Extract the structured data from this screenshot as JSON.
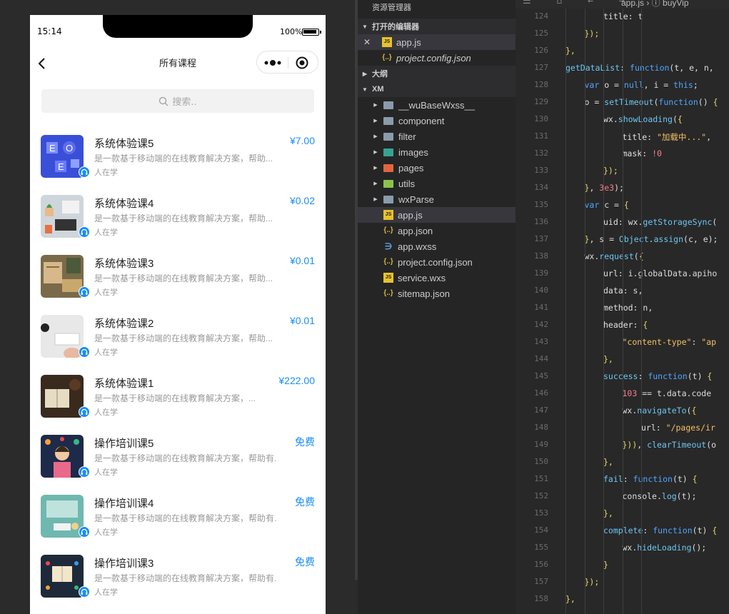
{
  "phone": {
    "status_time": "15:14",
    "battery_text": "100%",
    "nav_title": "所有课程",
    "search_placeholder": "搜索..",
    "courses": [
      {
        "title": "系统体验课5",
        "price": "¥7.00",
        "desc": "是一款基于移动端的在线教育解决方案，帮助...",
        "learners": "人在学",
        "thumb": "abc-blocks"
      },
      {
        "title": "系统体验课4",
        "price": "¥0.02",
        "desc": "是一款基于移动端的在线教育解决方案，帮助...",
        "learners": "人在学",
        "thumb": "desk-plant"
      },
      {
        "title": "系统体验课3",
        "price": "¥0.01",
        "desc": "是一款基于移动端的在线教育解决方案，帮助...",
        "learners": "人在学",
        "thumb": "notebook"
      },
      {
        "title": "系统体验课2",
        "price": "¥0.01",
        "desc": "是一款基于移动端的在线教育解决方案，帮助...",
        "learners": "人在学",
        "thumb": "keyboard"
      },
      {
        "title": "系统体验课1",
        "price": "¥222.00",
        "desc": "是一款基于移动端的在线教育解决方案，...",
        "learners": "人在学",
        "thumb": "book-coffee"
      },
      {
        "title": "操作培训课5",
        "price": "免费",
        "desc": "是一款基于移动端的在线教育解决方案，帮助有...",
        "learners": "人在学",
        "thumb": "teacher"
      },
      {
        "title": "操作培训课4",
        "price": "免费",
        "desc": "是一款基于移动端的在线教育解决方案，帮助有...",
        "learners": "人在学",
        "thumb": "classroom"
      },
      {
        "title": "操作培训课3",
        "price": "免费",
        "desc": "是一款基于移动端的在线教育解决方案，帮助有...",
        "learners": "人在学",
        "thumb": "infographic"
      }
    ]
  },
  "explorer": {
    "title": "资源管理器",
    "open_editors_label": "打开的编辑器",
    "outline_label": "大纲",
    "project_label": "XM",
    "open_files": [
      {
        "name": "app.js",
        "type": "js",
        "active": true
      },
      {
        "name": "project.config.json",
        "type": "json",
        "italic": true
      }
    ],
    "tree": [
      {
        "name": "__wuBaseWxss__",
        "kind": "folder",
        "color": "plain"
      },
      {
        "name": "component",
        "kind": "folder",
        "color": "plain"
      },
      {
        "name": "filter",
        "kind": "folder",
        "color": "plain"
      },
      {
        "name": "images",
        "kind": "folder",
        "color": "imgs"
      },
      {
        "name": "pages",
        "kind": "folder",
        "color": "pages"
      },
      {
        "name": "utils",
        "kind": "folder",
        "color": "utils"
      },
      {
        "name": "wxParse",
        "kind": "folder",
        "color": "plain"
      },
      {
        "name": "app.js",
        "kind": "js",
        "active": true
      },
      {
        "name": "app.json",
        "kind": "json"
      },
      {
        "name": "app.wxss",
        "kind": "css"
      },
      {
        "name": "project.config.json",
        "kind": "json"
      },
      {
        "name": "service.wxs",
        "kind": "js"
      },
      {
        "name": "sitemap.json",
        "kind": "json"
      }
    ]
  },
  "editor": {
    "breadcrumb": "app.js › ⓘ buyVip",
    "lines": [
      {
        "n": "124",
        "indent": 3,
        "html": "<span class=\"prop\">title</span>: t"
      },
      {
        "n": "125",
        "indent": 2,
        "html": "<span class=\"pun\">});</span>"
      },
      {
        "n": "126",
        "indent": 1,
        "html": "<span class=\"pun\">},</span>"
      },
      {
        "n": "127",
        "indent": 1,
        "html": "<span class=\"fn\">getDataList</span>: <span class=\"kw\">function</span>(t, e, n,"
      },
      {
        "n": "128",
        "indent": 2,
        "html": "<span class=\"kw\">var</span> o = <span class=\"kw\">null</span>, i = <span class=\"kw\">this</span>;"
      },
      {
        "n": "129",
        "indent": 2,
        "html": "o = <span class=\"fn\">setTimeout</span>(<span class=\"kw\">function</span>() <span class=\"pun\">{</span>"
      },
      {
        "n": "130",
        "indent": 3,
        "html": "wx.<span class=\"fn\">showLoading</span>(<span class=\"pun\">{</span>"
      },
      {
        "n": "131",
        "indent": 4,
        "html": "<span class=\"prop\">title</span>: <span class=\"str\">\"加载中...\"</span>,"
      },
      {
        "n": "132",
        "indent": 4,
        "html": "<span class=\"prop\">mask</span>: <span class=\"num\">!0</span>"
      },
      {
        "n": "133",
        "indent": 3,
        "html": "<span class=\"pun\">});</span>"
      },
      {
        "n": "134",
        "indent": 2,
        "html": "<span class=\"pun\">}</span>, <span class=\"num\">3e3</span>);"
      },
      {
        "n": "135",
        "indent": 2,
        "html": "<span class=\"kw\">var</span> c = <span class=\"pun\">{</span>"
      },
      {
        "n": "136",
        "indent": 3,
        "html": "<span class=\"prop\">uid</span>: wx.<span class=\"fn\">getStorageSync</span>("
      },
      {
        "n": "137",
        "indent": 2,
        "html": "<span class=\"pun\">}</span>, s = <span class=\"fn\">Object</span>.<span class=\"fn\">assign</span>(c, e);"
      },
      {
        "n": "138",
        "indent": 2,
        "html": "wx.<span class=\"fn\">request</span>(<span class=\"pun\">{</span>"
      },
      {
        "n": "139",
        "indent": 3,
        "html": "<span class=\"prop\">url</span>: i.globalData.apiho"
      },
      {
        "n": "140",
        "indent": 3,
        "html": "<span class=\"prop\">data</span>: s,"
      },
      {
        "n": "141",
        "indent": 3,
        "html": "<span class=\"prop\">method</span>: n,"
      },
      {
        "n": "142",
        "indent": 3,
        "html": "<span class=\"prop\">header</span>: <span class=\"pun\">{</span>"
      },
      {
        "n": "143",
        "indent": 4,
        "html": "<span class=\"str\">\"content-type\"</span>: <span class=\"str\">\"ap</span>"
      },
      {
        "n": "144",
        "indent": 3,
        "html": "<span class=\"pun\">},</span>"
      },
      {
        "n": "145",
        "indent": 3,
        "html": "<span class=\"fn\">success</span>: <span class=\"kw\">function</span>(t) <span class=\"pun\">{</span>"
      },
      {
        "n": "146",
        "indent": 4,
        "html": "<span class=\"num\">103</span> == t.data.code"
      },
      {
        "n": "147",
        "indent": 4,
        "html": "wx.<span class=\"fn\">navigateTo</span>(<span class=\"pun\">{</span>"
      },
      {
        "n": "148",
        "indent": 5,
        "html": "<span class=\"prop\">url</span>: <span class=\"str\">\"/pages/ir</span>"
      },
      {
        "n": "149",
        "indent": 4,
        "html": "<span class=\"pun\">}))</span>, <span class=\"fn\">clearTimeout</span>(o"
      },
      {
        "n": "150",
        "indent": 3,
        "html": "<span class=\"pun\">},</span>"
      },
      {
        "n": "151",
        "indent": 3,
        "html": "<span class=\"fn\">fail</span>: <span class=\"kw\">function</span>(t) <span class=\"pun\">{</span>"
      },
      {
        "n": "152",
        "indent": 4,
        "html": "console.<span class=\"fn\">log</span>(t);"
      },
      {
        "n": "153",
        "indent": 3,
        "html": "<span class=\"pun\">},</span>"
      },
      {
        "n": "154",
        "indent": 3,
        "html": "<span class=\"fn\">complete</span>: <span class=\"kw\">function</span>(t) <span class=\"pun\">{</span>"
      },
      {
        "n": "155",
        "indent": 4,
        "html": "wx.<span class=\"fn\">hideLoading</span>();"
      },
      {
        "n": "156",
        "indent": 3,
        "html": "<span class=\"pun\">}</span>"
      },
      {
        "n": "157",
        "indent": 2,
        "html": "<span class=\"pun\">});</span>"
      },
      {
        "n": "158",
        "indent": 1,
        "html": "<span class=\"pun\">},</span>"
      }
    ]
  }
}
